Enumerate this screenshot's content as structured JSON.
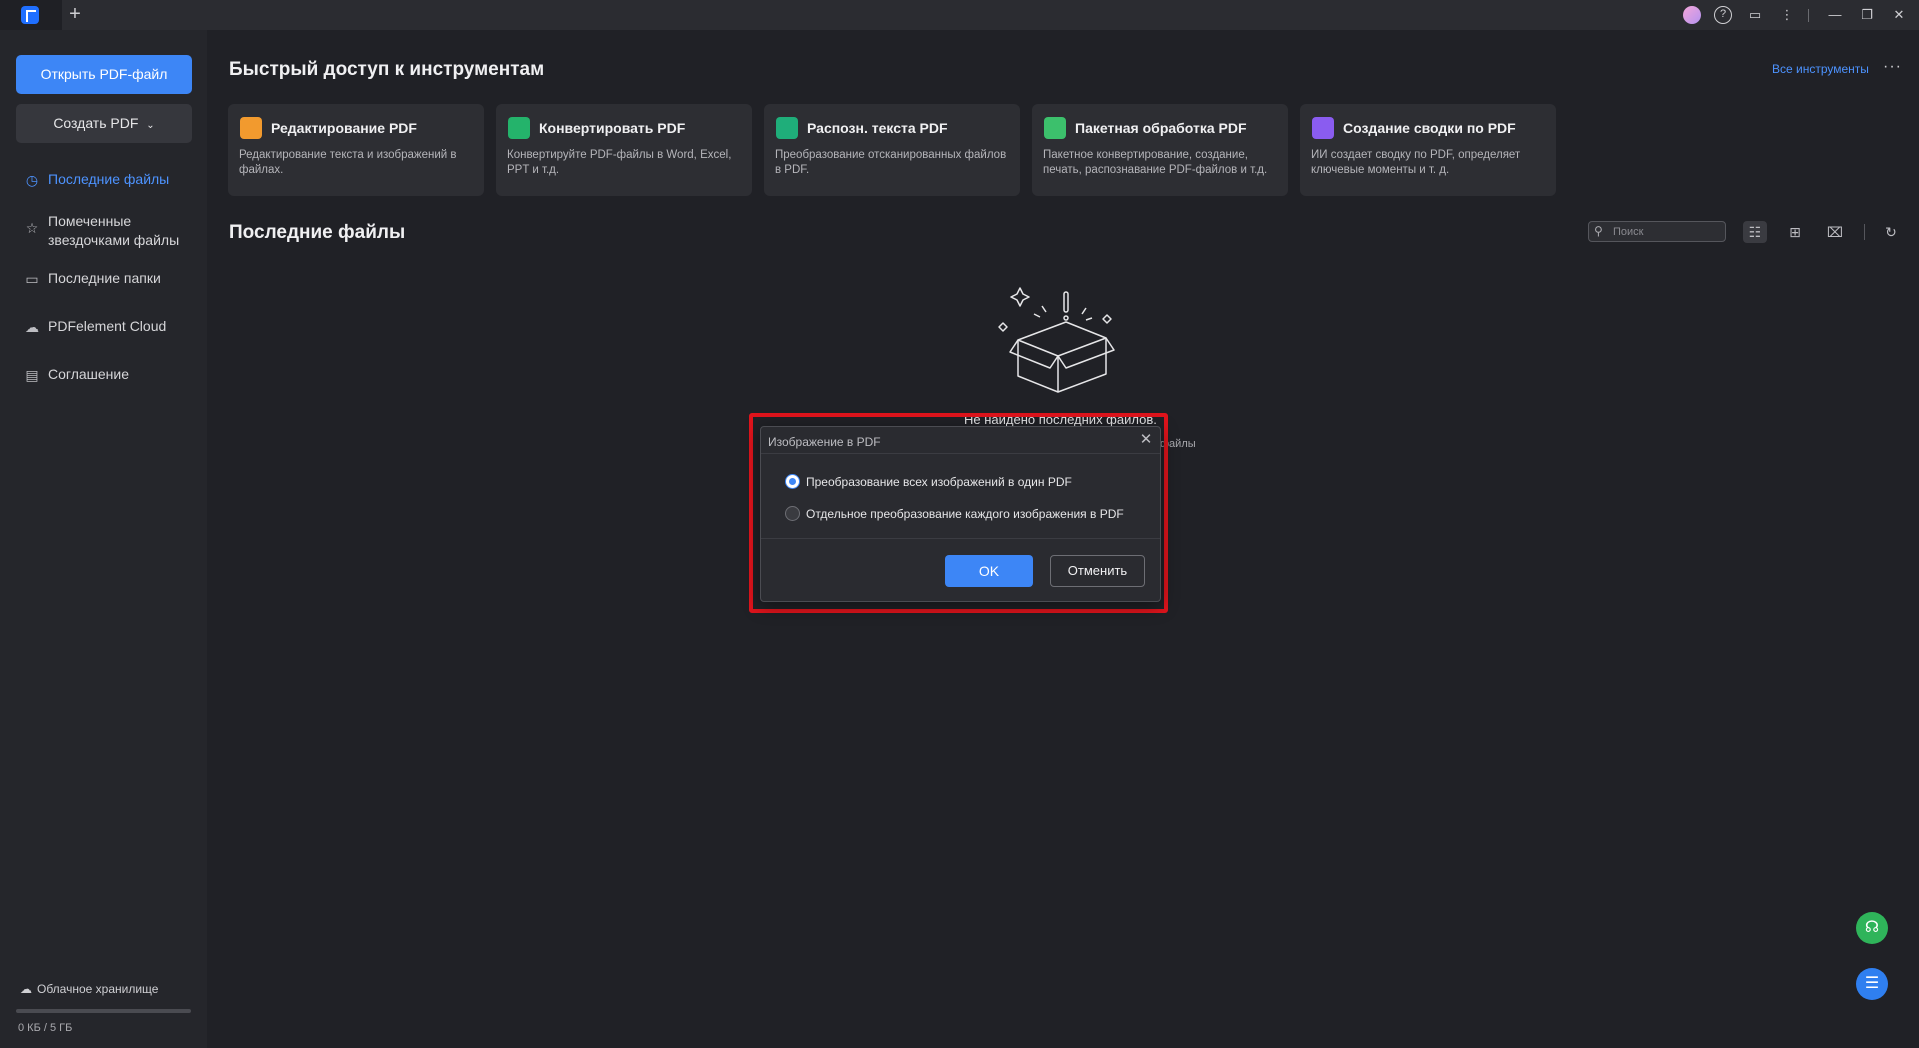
{
  "titlebar": {
    "new_tab_glyph": "+",
    "icons": [
      "avatar-icon",
      "help-icon",
      "feedback-icon",
      "more-vertical-icon",
      "minimize-icon",
      "restore-icon",
      "close-icon"
    ]
  },
  "sidebar": {
    "open_btn": "Открыть PDF-файл",
    "create_btn": "Создать PDF",
    "items": [
      {
        "label": "Последние файлы",
        "icon": "clock-icon",
        "active": true
      },
      {
        "label": "Помеченные звездочками файлы",
        "label_line1": "Помеченные",
        "label_line2": "звездочками файлы",
        "icon": "star-icon"
      },
      {
        "label": "Последние папки",
        "icon": "folder-icon"
      },
      {
        "label": "PDFelement Cloud",
        "icon": "cloud-icon"
      },
      {
        "label": "Соглашение",
        "icon": "document-icon"
      }
    ],
    "storage": {
      "label": "Облачное хранилище",
      "usage": "0 КБ / 5 ГБ",
      "used_fraction": 0
    }
  },
  "main": {
    "quick_title": "Быстрый доступ к инструментам",
    "all_tools": "Все инструменты",
    "tools": [
      {
        "title": "Редактирование PDF",
        "desc": "Редактирование текста и изображений в файлах.",
        "icon": "edit-pdf-icon",
        "color": "#f29a2e"
      },
      {
        "title": "Конвертировать PDF",
        "desc": "Конвертируйте PDF-файлы в Word, Excel, PPT и т.д.",
        "icon": "convert-pdf-icon",
        "color": "#24b36b"
      },
      {
        "title": "Распозн. текста PDF",
        "desc": "Преобразование отсканированных файлов в PDF.",
        "icon": "ocr-icon",
        "color": "#1fae7a"
      },
      {
        "title": "Пакетная обработка PDF",
        "desc": "Пакетное конвертирование, создание, печать, распознавание PDF-файлов и т.д.",
        "icon": "batch-icon",
        "color": "#3cc06c"
      },
      {
        "title": "Создание сводки по PDF",
        "desc": "ИИ создает сводку по PDF, определяет ключевые моменты и т. д.",
        "icon": "summary-icon",
        "color": "#8a5cf0"
      }
    ],
    "recent_title": "Последние файлы",
    "search_placeholder": "Поиск",
    "empty_title": "Не найдено последних файлов.",
    "empty_sub": "файлы"
  },
  "dialog": {
    "title": "Изображение в PDF",
    "options": [
      {
        "label": "Преобразование всех изображений в один PDF",
        "checked": true
      },
      {
        "label": "Отдельное преобразование каждого изображения в PDF",
        "checked": false
      }
    ],
    "ok": "OK",
    "cancel": "Отменить"
  },
  "colors": {
    "accent": "#3d86f6",
    "highlight": "#e0141c",
    "support_green": "#2fb45a"
  }
}
